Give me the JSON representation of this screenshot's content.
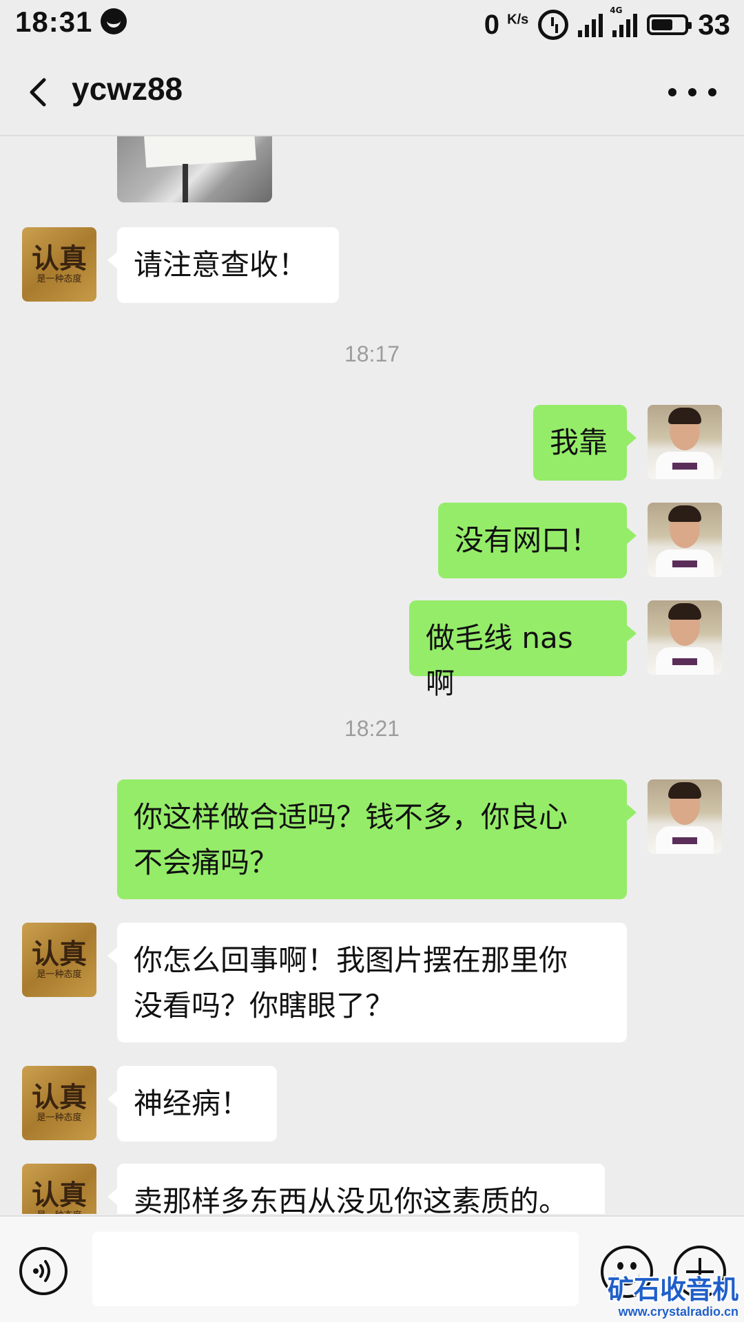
{
  "status_bar": {
    "time": "18:31",
    "net_speed_value": "0",
    "net_speed_unit": "K/s",
    "network": "4G",
    "battery_level": "33"
  },
  "header": {
    "title": "ycwz88"
  },
  "contact_avatar": {
    "big_text": "认真",
    "small_text": "是一种态度"
  },
  "messages": [
    {
      "side": "left",
      "text": "请注意查收！"
    },
    {
      "side": "right",
      "text": "我靠"
    },
    {
      "side": "right",
      "text": "没有网口！"
    },
    {
      "side": "right",
      "text": "做毛线 nas 啊"
    },
    {
      "side": "right",
      "text": "你这样做合适吗？钱不多，你良心\n不会痛吗？"
    },
    {
      "side": "left",
      "text": "你怎么回事啊！我图片摆在那里你\n没看吗？你瞎眼了？"
    },
    {
      "side": "left",
      "text": "神经病！"
    },
    {
      "side": "left",
      "text": "卖那样多东西从没见你这素质的。"
    }
  ],
  "time_separators": [
    "18:17",
    "18:21"
  ],
  "input": {
    "placeholder": ""
  },
  "watermark": {
    "title": "矿石收音机",
    "url": "www.crystalradio.cn"
  }
}
